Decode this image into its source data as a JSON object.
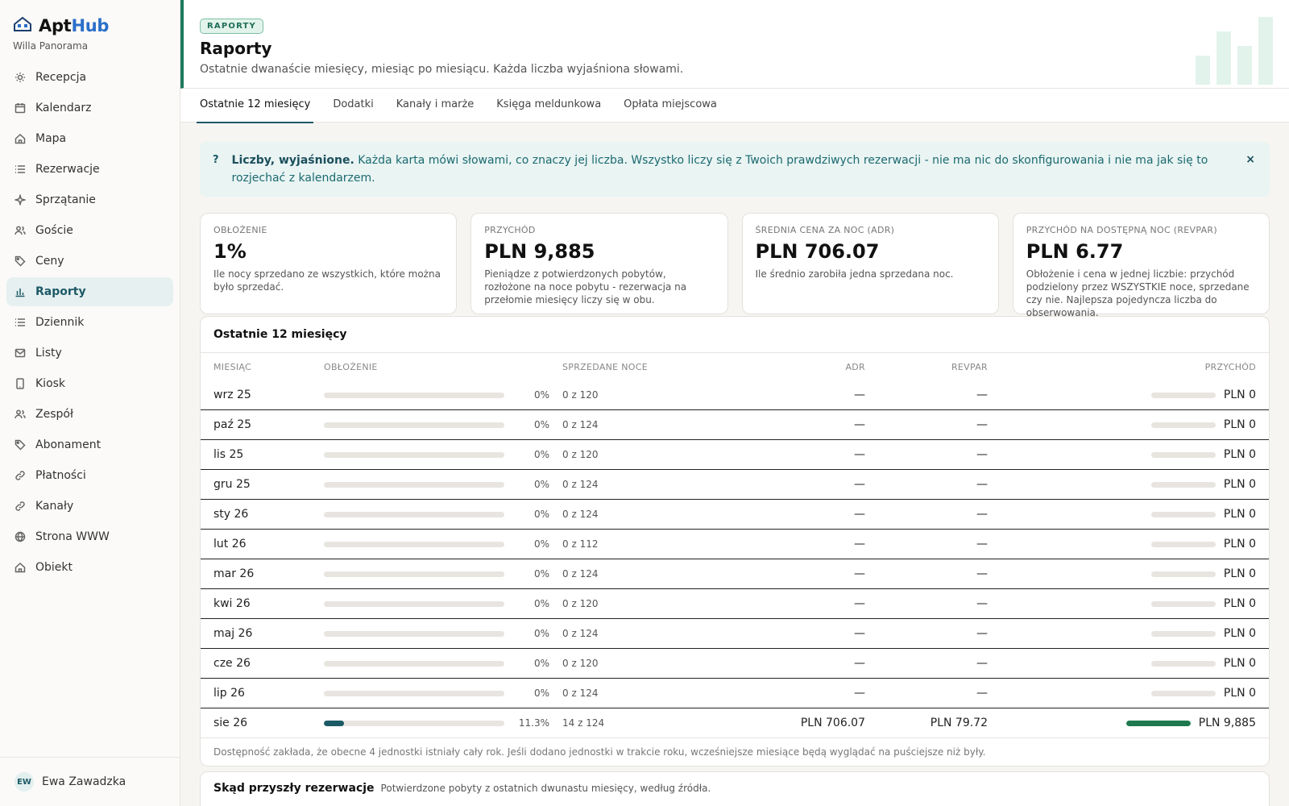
{
  "brand": {
    "name_a": "Apt",
    "name_b": "Hub",
    "property": "Willa Panorama"
  },
  "sidebar": {
    "items": [
      {
        "label": "Recepcja",
        "icon": "sun-icon"
      },
      {
        "label": "Kalendarz",
        "icon": "calendar-icon"
      },
      {
        "label": "Mapa",
        "icon": "home-icon"
      },
      {
        "label": "Rezerwacje",
        "icon": "list-icon"
      },
      {
        "label": "Sprzątanie",
        "icon": "sparkle-icon"
      },
      {
        "label": "Goście",
        "icon": "users-icon"
      },
      {
        "label": "Ceny",
        "icon": "tag-icon"
      },
      {
        "label": "Raporty",
        "icon": "bar-chart-icon",
        "active": true
      },
      {
        "label": "Dziennik",
        "icon": "list-icon"
      },
      {
        "label": "Listy",
        "icon": "mail-icon"
      },
      {
        "label": "Kiosk",
        "icon": "tablet-icon"
      },
      {
        "label": "Zespół",
        "icon": "users-icon"
      },
      {
        "label": "Abonament",
        "icon": "tag-icon"
      },
      {
        "label": "Płatności",
        "icon": "link-icon"
      },
      {
        "label": "Kanały",
        "icon": "link-icon"
      },
      {
        "label": "Strona WWW",
        "icon": "globe-icon"
      },
      {
        "label": "Obiekt",
        "icon": "home-icon"
      }
    ]
  },
  "user": {
    "initials": "EW",
    "name": "Ewa Zawadzka"
  },
  "header": {
    "badge": "RAPORTY",
    "title": "Raporty",
    "subtitle": "Ostatnie dwanaście miesięcy, miesiąc po miesiącu. Każda liczba wyjaśniona słowami."
  },
  "tabs": [
    "Ostatnie 12 miesięcy",
    "Dodatki",
    "Kanały i marże",
    "Księga meldunkowa",
    "Opłata miejscowa"
  ],
  "notice": {
    "icon": "?",
    "bold": "Liczby, wyjaśnione.",
    "text": " Każda karta mówi słowami, co znaczy jej liczba. Wszystko liczy się z Twoich prawdziwych rezerwacji - nie ma nic do skonfigurowania i nie ma jak się to rozjechać z kalendarzem.",
    "close": "×"
  },
  "kpis": [
    {
      "label": "OBŁOŻENIE",
      "value": "1%",
      "desc": "Ile nocy sprzedano ze wszystkich, które można było sprzedać."
    },
    {
      "label": "PRZYCHÓD",
      "value": "PLN 9,885",
      "desc": "Pieniądze z potwierdzonych pobytów, rozłożone na noce pobytu - rezerwacja na przełomie miesięcy liczy się w obu."
    },
    {
      "label": "ŚREDNIA CENA ZA NOC (ADR)",
      "value": "PLN 706.07",
      "desc": "Ile średnio zarobiła jedna sprzedana noc."
    },
    {
      "label": "PRZYCHÓD NA DOSTĘPNĄ NOC (REVPAR)",
      "value": "PLN 6.77",
      "desc": "Obłożenie i cena w jednej liczbie: przychód podzielony przez WSZYSTKIE noce, sprzedane czy nie. Najlepsza pojedyncza liczba do obserwowania."
    }
  ],
  "table": {
    "title": "Ostatnie 12 miesięcy",
    "headers": {
      "month": "MIESIĄC",
      "occupancy": "OBŁOŻENIE",
      "nights": "SPRZEDANE NOCE",
      "adr": "ADR",
      "revpar": "REVPAR",
      "revenue": "PRZYCHÓD"
    },
    "rows": [
      {
        "month": "wrz 25",
        "occ": 0,
        "pct": "0%",
        "nights": "0 z 120",
        "adr": "—",
        "revpar": "—",
        "rev": "PLN 0",
        "rev_frac": 0
      },
      {
        "month": "paź 25",
        "occ": 0,
        "pct": "0%",
        "nights": "0 z 124",
        "adr": "—",
        "revpar": "—",
        "rev": "PLN 0",
        "rev_frac": 0
      },
      {
        "month": "lis 25",
        "occ": 0,
        "pct": "0%",
        "nights": "0 z 120",
        "adr": "—",
        "revpar": "—",
        "rev": "PLN 0",
        "rev_frac": 0
      },
      {
        "month": "gru 25",
        "occ": 0,
        "pct": "0%",
        "nights": "0 z 124",
        "adr": "—",
        "revpar": "—",
        "rev": "PLN 0",
        "rev_frac": 0
      },
      {
        "month": "sty 26",
        "occ": 0,
        "pct": "0%",
        "nights": "0 z 124",
        "adr": "—",
        "revpar": "—",
        "rev": "PLN 0",
        "rev_frac": 0
      },
      {
        "month": "lut 26",
        "occ": 0,
        "pct": "0%",
        "nights": "0 z 112",
        "adr": "—",
        "revpar": "—",
        "rev": "PLN 0",
        "rev_frac": 0
      },
      {
        "month": "mar 26",
        "occ": 0,
        "pct": "0%",
        "nights": "0 z 124",
        "adr": "—",
        "revpar": "—",
        "rev": "PLN 0",
        "rev_frac": 0
      },
      {
        "month": "kwi 26",
        "occ": 0,
        "pct": "0%",
        "nights": "0 z 120",
        "adr": "—",
        "revpar": "—",
        "rev": "PLN 0",
        "rev_frac": 0
      },
      {
        "month": "maj 26",
        "occ": 0,
        "pct": "0%",
        "nights": "0 z 124",
        "adr": "—",
        "revpar": "—",
        "rev": "PLN 0",
        "rev_frac": 0
      },
      {
        "month": "cze 26",
        "occ": 0,
        "pct": "0%",
        "nights": "0 z 120",
        "adr": "—",
        "revpar": "—",
        "rev": "PLN 0",
        "rev_frac": 0
      },
      {
        "month": "lip 26",
        "occ": 0,
        "pct": "0%",
        "nights": "0 z 124",
        "adr": "—",
        "revpar": "—",
        "rev": "PLN 0",
        "rev_frac": 0
      },
      {
        "month": "sie 26",
        "occ": 0.113,
        "pct": "11.3%",
        "nights": "14 z 124",
        "adr": "PLN 706.07",
        "revpar": "PLN 79.72",
        "rev": "PLN 9,885",
        "rev_frac": 1
      }
    ],
    "footnote": "Dostępność zakłada, że obecne 4 jednostki istniały cały rok. Jeśli dodano jednostki w trakcie roku, wcześniejsze miesiące będą wyglądać na puściejsze niż były."
  },
  "sources": {
    "title": "Skąd przyszły rezerwacje",
    "subtitle": "Potwierdzone pobyty z ostatnich dwunastu miesięcy, według źródła."
  },
  "colors": {
    "accent": "#1c5a66",
    "brand_green": "#1e7a5e",
    "revenue_bar": "#1e7a4e",
    "brand_blue": "#2b6fc9"
  }
}
